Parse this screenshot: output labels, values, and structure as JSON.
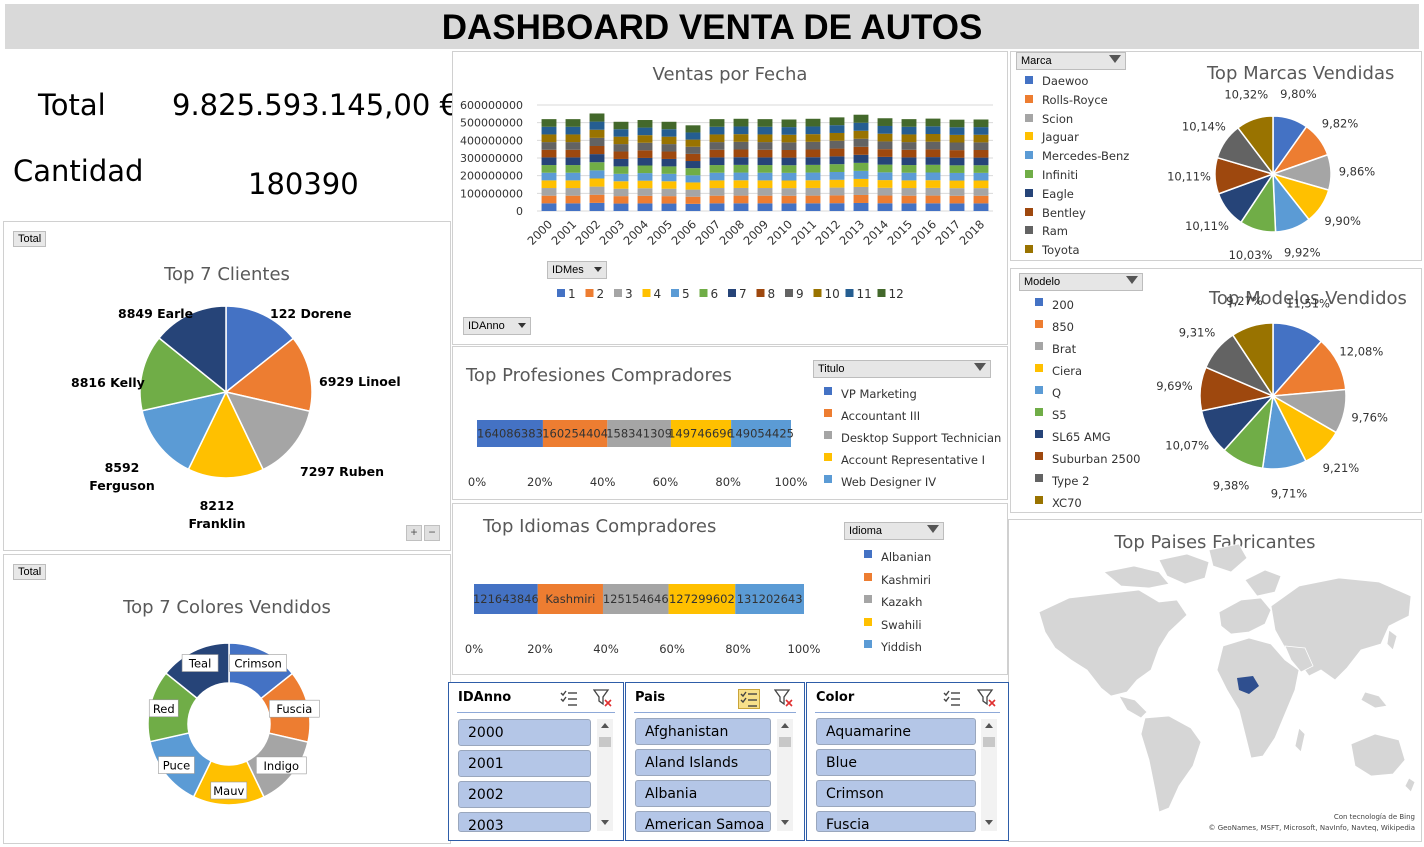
{
  "header": {
    "title": "DASHBOARD VENTA DE AUTOS"
  },
  "kpis": {
    "total_label": "Total",
    "total_value": "9.825.593.145,00 €",
    "qty_label": "Cantidad",
    "qty_value": "180390"
  },
  "palette": [
    "#4472c4",
    "#ed7d31",
    "#a5a5a5",
    "#ffc000",
    "#5b9bd5",
    "#70ad47",
    "#264478",
    "#9e480e",
    "#636363",
    "#997300",
    "#255e91",
    "#43682b"
  ],
  "clients": {
    "tag": "Total",
    "title": "Top 7 Clientes",
    "chart_data": {
      "type": "pie",
      "labels": [
        "122 Dorene",
        "6929 Linoel",
        "7297 Ruben",
        "8212 Franklin",
        "8592 Ferguson",
        "8816 Kelly",
        "8849 Earle"
      ],
      "values": [
        14.3,
        14.3,
        14.3,
        14.3,
        14.3,
        14.3,
        14.2
      ]
    }
  },
  "colors": {
    "tag": "Total",
    "title": "Top 7 Colores Vendidos",
    "chart_data": {
      "type": "pie",
      "labels": [
        "Crimson",
        "Fuscia",
        "Indigo",
        "Mauv",
        "Puce",
        "Red",
        "Teal"
      ],
      "values": [
        14.3,
        14.3,
        14.3,
        14.3,
        14.3,
        14.3,
        14.2
      ]
    }
  },
  "sales_by_date": {
    "title": "Ventas por Fecha",
    "field_month": "IDMes",
    "field_year": "IDAnno",
    "chart_data": {
      "type": "bar",
      "stacked": true,
      "categories": [
        "2000",
        "2001",
        "2002",
        "2003",
        "2004",
        "2005",
        "2006",
        "2007",
        "2008",
        "2009",
        "2010",
        "2011",
        "2012",
        "2013",
        "2014",
        "2015",
        "2016",
        "2017",
        "2018"
      ],
      "totals": [
        520000000,
        520000000,
        552000000,
        505000000,
        515000000,
        505000000,
        485000000,
        520000000,
        522000000,
        520000000,
        518000000,
        522000000,
        530000000,
        545000000,
        525000000,
        520000000,
        523000000,
        517000000,
        518000000
      ],
      "series_names": [
        "1",
        "2",
        "3",
        "4",
        "5",
        "6",
        "7",
        "8",
        "9",
        "10",
        "11",
        "12"
      ],
      "yticks": [
        "0",
        "100000000",
        "200000000",
        "300000000",
        "400000000",
        "500000000",
        "600000000"
      ],
      "ylim": [
        0,
        600000000
      ]
    }
  },
  "professions": {
    "title": "Top Profesiones Compradores",
    "filter_label": "Titulo",
    "chart_data": {
      "type": "bar",
      "stacked_percent": true,
      "series": [
        {
          "name": "VP Marketing",
          "value": 164086383,
          "label": "164086383"
        },
        {
          "name": "Accountant III",
          "value": 160254404,
          "label": "160254404"
        },
        {
          "name": "Desktop Support Technician",
          "value": 158341309,
          "label": "158341309"
        },
        {
          "name": "Account Representative I",
          "value": 149746696,
          "label": "149746696"
        },
        {
          "name": "Web Designer IV",
          "value": 149054425,
          "label": "149054425"
        }
      ],
      "xticks": [
        "0%",
        "20%",
        "40%",
        "60%",
        "80%",
        "100%"
      ]
    }
  },
  "languages": {
    "title": "Top Idiomas Compradores",
    "filter_label": "Idioma",
    "chart_data": {
      "type": "bar",
      "stacked_percent": true,
      "series": [
        {
          "name": "Albanian",
          "value": 121643846,
          "label": "121643846"
        },
        {
          "name": "Kashmiri",
          "value": 124500000,
          "label": "Kashmiri"
        },
        {
          "name": "Kazakh",
          "value": 125154646,
          "label": "125154646"
        },
        {
          "name": "Swahili",
          "value": 127299602,
          "label": "127299602"
        },
        {
          "name": "Yiddish",
          "value": 131202643,
          "label": "131202643"
        }
      ],
      "xticks": [
        "0%",
        "20%",
        "40%",
        "60%",
        "80%",
        "100%"
      ]
    }
  },
  "brands": {
    "title": "Top Marcas Vendidas",
    "filter_label": "Marca",
    "chart_data": {
      "type": "pie",
      "labels": [
        "Daewoo",
        "Rolls-Royce",
        "Scion",
        "Jaguar",
        "Mercedes-Benz",
        "Infiniti",
        "Eagle",
        "Bentley",
        "Ram",
        "Toyota"
      ],
      "values": [
        9.8,
        9.82,
        9.86,
        9.9,
        9.92,
        10.03,
        10.11,
        10.11,
        10.14,
        10.32
      ],
      "value_labels": [
        "9,80%",
        "9,82%",
        "9,86%",
        "9,90%",
        "9,92%",
        "10,03%",
        "10,11%",
        "10,11%",
        "10,14%",
        "10,32%"
      ]
    }
  },
  "models": {
    "title": "Top Modelos Vendidos",
    "filter_label": "Modelo",
    "chart_data": {
      "type": "pie",
      "labels": [
        "200",
        "850",
        "Brat",
        "Ciera",
        "Q",
        "S5",
        "SL65 AMG",
        "Suburban 2500",
        "Type 2",
        "XC70"
      ],
      "values": [
        11.51,
        12.08,
        9.76,
        9.21,
        9.71,
        9.38,
        10.07,
        9.69,
        9.31,
        9.27
      ],
      "value_labels": [
        "11,51%",
        "12,08%",
        "9,76%",
        "9,21%",
        "9,71%",
        "9,38%",
        "10,07%",
        "9,69%",
        "9,31%",
        "9,27%"
      ]
    }
  },
  "map": {
    "title": "Top Paises Fabricantes",
    "credit1": "Con tecnología de Bing",
    "credit2": "© GeoNames, MSFT, Microsoft, NavInfo, Navteq, Wikipedia"
  },
  "slicers": {
    "year": {
      "title": "IDAnno",
      "items": [
        "2000",
        "2001",
        "2002",
        "2003"
      ]
    },
    "country": {
      "title": "Pais",
      "items": [
        "Afghanistan",
        "Aland Islands",
        "Albania",
        "American Samoa"
      ]
    },
    "color": {
      "title": "Color",
      "items": [
        "Aquamarine",
        "Blue",
        "Crimson",
        "Fuscia"
      ]
    }
  }
}
